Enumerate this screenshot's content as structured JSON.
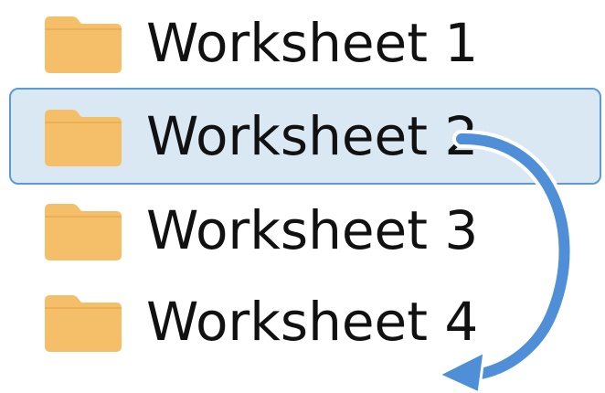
{
  "colors": {
    "folder": "#f5bf6a",
    "folder_shade": "#e8ac4f",
    "selection_fill": "#dae8f4",
    "selection_border": "#5b9bd5",
    "arrow": "#4f8fd8"
  },
  "items": [
    {
      "label": "Worksheet 1",
      "icon": "folder-icon",
      "selected": false
    },
    {
      "label": "Worksheet 2",
      "icon": "folder-icon",
      "selected": true
    },
    {
      "label": "Worksheet 3",
      "icon": "folder-icon",
      "selected": false
    },
    {
      "label": "Worksheet 4",
      "icon": "folder-icon",
      "selected": false
    }
  ],
  "drag_indicator": {
    "icon": "curved-arrow-down-icon"
  }
}
